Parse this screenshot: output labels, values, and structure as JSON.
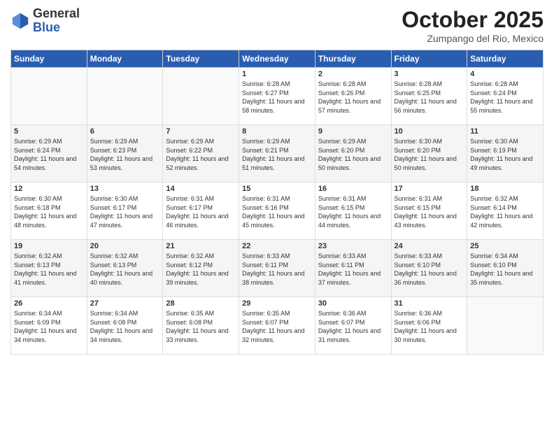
{
  "header": {
    "logo_general": "General",
    "logo_blue": "Blue",
    "month_title": "October 2025",
    "location": "Zumpango del Rio, Mexico"
  },
  "weekdays": [
    "Sunday",
    "Monday",
    "Tuesday",
    "Wednesday",
    "Thursday",
    "Friday",
    "Saturday"
  ],
  "weeks": [
    [
      {
        "day": "",
        "sunrise": "",
        "sunset": "",
        "daylight": ""
      },
      {
        "day": "",
        "sunrise": "",
        "sunset": "",
        "daylight": ""
      },
      {
        "day": "",
        "sunrise": "",
        "sunset": "",
        "daylight": ""
      },
      {
        "day": "1",
        "sunrise": "6:28 AM",
        "sunset": "6:27 PM",
        "daylight": "11 hours and 58 minutes."
      },
      {
        "day": "2",
        "sunrise": "6:28 AM",
        "sunset": "6:26 PM",
        "daylight": "11 hours and 57 minutes."
      },
      {
        "day": "3",
        "sunrise": "6:28 AM",
        "sunset": "6:25 PM",
        "daylight": "11 hours and 56 minutes."
      },
      {
        "day": "4",
        "sunrise": "6:28 AM",
        "sunset": "6:24 PM",
        "daylight": "11 hours and 55 minutes."
      }
    ],
    [
      {
        "day": "5",
        "sunrise": "6:29 AM",
        "sunset": "6:24 PM",
        "daylight": "11 hours and 54 minutes."
      },
      {
        "day": "6",
        "sunrise": "6:29 AM",
        "sunset": "6:23 PM",
        "daylight": "11 hours and 53 minutes."
      },
      {
        "day": "7",
        "sunrise": "6:29 AM",
        "sunset": "6:22 PM",
        "daylight": "11 hours and 52 minutes."
      },
      {
        "day": "8",
        "sunrise": "6:29 AM",
        "sunset": "6:21 PM",
        "daylight": "11 hours and 51 minutes."
      },
      {
        "day": "9",
        "sunrise": "6:29 AM",
        "sunset": "6:20 PM",
        "daylight": "11 hours and 50 minutes."
      },
      {
        "day": "10",
        "sunrise": "6:30 AM",
        "sunset": "6:20 PM",
        "daylight": "11 hours and 50 minutes."
      },
      {
        "day": "11",
        "sunrise": "6:30 AM",
        "sunset": "6:19 PM",
        "daylight": "11 hours and 49 minutes."
      }
    ],
    [
      {
        "day": "12",
        "sunrise": "6:30 AM",
        "sunset": "6:18 PM",
        "daylight": "11 hours and 48 minutes."
      },
      {
        "day": "13",
        "sunrise": "6:30 AM",
        "sunset": "6:17 PM",
        "daylight": "11 hours and 47 minutes."
      },
      {
        "day": "14",
        "sunrise": "6:31 AM",
        "sunset": "6:17 PM",
        "daylight": "11 hours and 46 minutes."
      },
      {
        "day": "15",
        "sunrise": "6:31 AM",
        "sunset": "6:16 PM",
        "daylight": "11 hours and 45 minutes."
      },
      {
        "day": "16",
        "sunrise": "6:31 AM",
        "sunset": "6:15 PM",
        "daylight": "11 hours and 44 minutes."
      },
      {
        "day": "17",
        "sunrise": "6:31 AM",
        "sunset": "6:15 PM",
        "daylight": "11 hours and 43 minutes."
      },
      {
        "day": "18",
        "sunrise": "6:32 AM",
        "sunset": "6:14 PM",
        "daylight": "11 hours and 42 minutes."
      }
    ],
    [
      {
        "day": "19",
        "sunrise": "6:32 AM",
        "sunset": "6:13 PM",
        "daylight": "11 hours and 41 minutes."
      },
      {
        "day": "20",
        "sunrise": "6:32 AM",
        "sunset": "6:13 PM",
        "daylight": "11 hours and 40 minutes."
      },
      {
        "day": "21",
        "sunrise": "6:32 AM",
        "sunset": "6:12 PM",
        "daylight": "11 hours and 39 minutes."
      },
      {
        "day": "22",
        "sunrise": "6:33 AM",
        "sunset": "6:11 PM",
        "daylight": "11 hours and 38 minutes."
      },
      {
        "day": "23",
        "sunrise": "6:33 AM",
        "sunset": "6:11 PM",
        "daylight": "11 hours and 37 minutes."
      },
      {
        "day": "24",
        "sunrise": "6:33 AM",
        "sunset": "6:10 PM",
        "daylight": "11 hours and 36 minutes."
      },
      {
        "day": "25",
        "sunrise": "6:34 AM",
        "sunset": "6:10 PM",
        "daylight": "11 hours and 35 minutes."
      }
    ],
    [
      {
        "day": "26",
        "sunrise": "6:34 AM",
        "sunset": "6:09 PM",
        "daylight": "11 hours and 34 minutes."
      },
      {
        "day": "27",
        "sunrise": "6:34 AM",
        "sunset": "6:08 PM",
        "daylight": "11 hours and 34 minutes."
      },
      {
        "day": "28",
        "sunrise": "6:35 AM",
        "sunset": "6:08 PM",
        "daylight": "11 hours and 33 minutes."
      },
      {
        "day": "29",
        "sunrise": "6:35 AM",
        "sunset": "6:07 PM",
        "daylight": "11 hours and 32 minutes."
      },
      {
        "day": "30",
        "sunrise": "6:36 AM",
        "sunset": "6:07 PM",
        "daylight": "11 hours and 31 minutes."
      },
      {
        "day": "31",
        "sunrise": "6:36 AM",
        "sunset": "6:06 PM",
        "daylight": "11 hours and 30 minutes."
      },
      {
        "day": "",
        "sunrise": "",
        "sunset": "",
        "daylight": ""
      }
    ]
  ]
}
